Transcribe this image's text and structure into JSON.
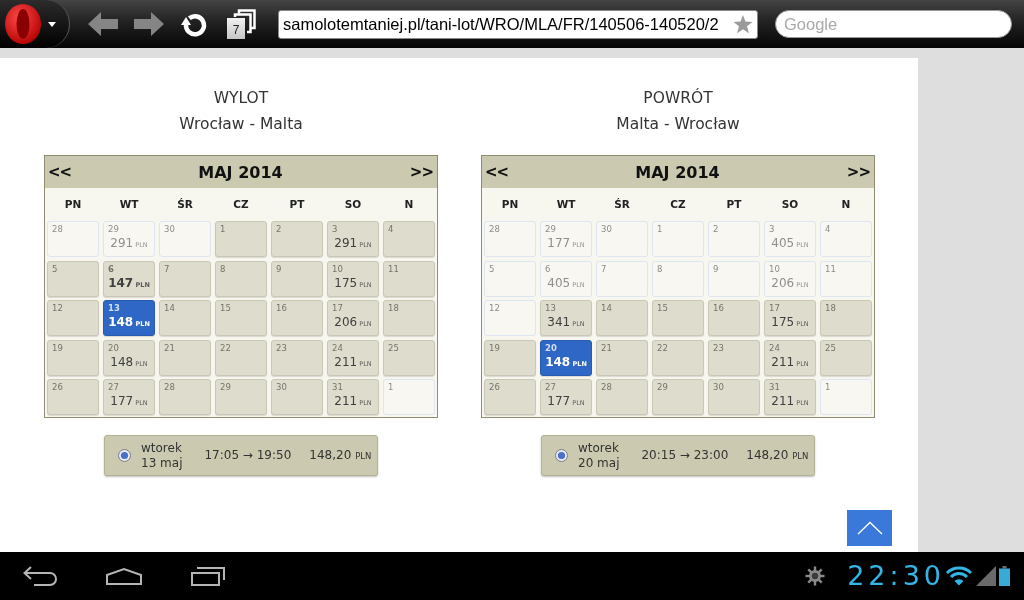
{
  "browser": {
    "nav_buttons": [
      {
        "kind": "back",
        "disabled": true
      },
      {
        "kind": "forward",
        "disabled": true
      },
      {
        "kind": "reload",
        "disabled": false
      }
    ],
    "tab_count": "7",
    "url": "samolotemtaniej.pl/tani-lot/WRO/MLA/FR/140506-140520/2",
    "search_placeholder": "Google"
  },
  "sections": [
    {
      "title": "WYLOT",
      "route": "Wrocław - Malta",
      "calendar": {
        "prev": "<<",
        "month": "MAJ 2014",
        "next": ">>",
        "weekdays": [
          "PN",
          "WT",
          "ŚR",
          "CZ",
          "PT",
          "SO",
          "N"
        ],
        "days": [
          {
            "day": "28",
            "disabled": true,
            "selected": false,
            "highlighted": false
          },
          {
            "day": "29",
            "price": "291",
            "currency": "PLN",
            "disabled": true,
            "selected": false,
            "highlighted": false
          },
          {
            "day": "30",
            "disabled": true,
            "selected": false,
            "highlighted": false
          },
          {
            "day": "1",
            "disabled": false,
            "selected": false,
            "highlighted": false
          },
          {
            "day": "2",
            "disabled": false,
            "selected": false,
            "highlighted": false
          },
          {
            "day": "3",
            "price": "291",
            "currency": "PLN",
            "disabled": false,
            "selected": false,
            "highlighted": false
          },
          {
            "day": "4",
            "disabled": false,
            "selected": false,
            "highlighted": false
          },
          {
            "day": "5",
            "disabled": false,
            "selected": false,
            "highlighted": false
          },
          {
            "day": "6",
            "price": "147",
            "currency": "PLN",
            "disabled": false,
            "selected": false,
            "highlighted": true
          },
          {
            "day": "7",
            "disabled": false,
            "selected": false,
            "highlighted": false
          },
          {
            "day": "8",
            "disabled": false,
            "selected": false,
            "highlighted": false
          },
          {
            "day": "9",
            "disabled": false,
            "selected": false,
            "highlighted": false
          },
          {
            "day": "10",
            "price": "175",
            "currency": "PLN",
            "disabled": false,
            "selected": false,
            "highlighted": false
          },
          {
            "day": "11",
            "disabled": false,
            "selected": false,
            "highlighted": false
          },
          {
            "day": "12",
            "disabled": false,
            "selected": false,
            "highlighted": false
          },
          {
            "day": "13",
            "price": "148",
            "currency": "PLN",
            "disabled": false,
            "selected": true,
            "highlighted": false
          },
          {
            "day": "14",
            "disabled": false,
            "selected": false,
            "highlighted": false
          },
          {
            "day": "15",
            "disabled": false,
            "selected": false,
            "highlighted": false
          },
          {
            "day": "16",
            "disabled": false,
            "selected": false,
            "highlighted": false
          },
          {
            "day": "17",
            "price": "206",
            "currency": "PLN",
            "disabled": false,
            "selected": false,
            "highlighted": false
          },
          {
            "day": "18",
            "disabled": false,
            "selected": false,
            "highlighted": false
          },
          {
            "day": "19",
            "disabled": false,
            "selected": false,
            "highlighted": false
          },
          {
            "day": "20",
            "price": "148",
            "currency": "PLN",
            "disabled": false,
            "selected": false,
            "highlighted": false
          },
          {
            "day": "21",
            "disabled": false,
            "selected": false,
            "highlighted": false
          },
          {
            "day": "22",
            "disabled": false,
            "selected": false,
            "highlighted": false
          },
          {
            "day": "23",
            "disabled": false,
            "selected": false,
            "highlighted": false
          },
          {
            "day": "24",
            "price": "211",
            "currency": "PLN",
            "disabled": false,
            "selected": false,
            "highlighted": false
          },
          {
            "day": "25",
            "disabled": false,
            "selected": false,
            "highlighted": false
          },
          {
            "day": "26",
            "disabled": false,
            "selected": false,
            "highlighted": false
          },
          {
            "day": "27",
            "price": "177",
            "currency": "PLN",
            "disabled": false,
            "selected": false,
            "highlighted": false
          },
          {
            "day": "28",
            "disabled": false,
            "selected": false,
            "highlighted": false
          },
          {
            "day": "29",
            "disabled": false,
            "selected": false,
            "highlighted": false
          },
          {
            "day": "30",
            "disabled": false,
            "selected": false,
            "highlighted": false
          },
          {
            "day": "31",
            "price": "211",
            "currency": "PLN",
            "disabled": false,
            "selected": false,
            "highlighted": false
          },
          {
            "day": "1",
            "disabled": true,
            "selected": false,
            "highlighted": false
          }
        ]
      },
      "flight": {
        "selected": true,
        "weekday": "wtorek",
        "date": "13 maj",
        "times": "17:05 → 19:50",
        "price": "148,20",
        "currency": "PLN"
      }
    },
    {
      "title": "POWRÓT",
      "route": "Malta - Wrocław",
      "calendar": {
        "prev": "<<",
        "month": "MAJ 2014",
        "next": ">>",
        "weekdays": [
          "PN",
          "WT",
          "ŚR",
          "CZ",
          "PT",
          "SO",
          "N"
        ],
        "days": [
          {
            "day": "28",
            "disabled": true,
            "selected": false,
            "highlighted": false
          },
          {
            "day": "29",
            "price": "177",
            "currency": "PLN",
            "disabled": true,
            "selected": false,
            "highlighted": false
          },
          {
            "day": "30",
            "disabled": true,
            "selected": false,
            "highlighted": false
          },
          {
            "day": "1",
            "disabled": true,
            "selected": false,
            "highlighted": false
          },
          {
            "day": "2",
            "disabled": true,
            "selected": false,
            "highlighted": false
          },
          {
            "day": "3",
            "price": "405",
            "currency": "PLN",
            "disabled": true,
            "selected": false,
            "highlighted": false
          },
          {
            "day": "4",
            "disabled": true,
            "selected": false,
            "highlighted": false
          },
          {
            "day": "5",
            "disabled": true,
            "selected": false,
            "highlighted": false
          },
          {
            "day": "6",
            "price": "405",
            "currency": "PLN",
            "disabled": true,
            "selected": false,
            "highlighted": false
          },
          {
            "day": "7",
            "disabled": true,
            "selected": false,
            "highlighted": false
          },
          {
            "day": "8",
            "disabled": true,
            "selected": false,
            "highlighted": false
          },
          {
            "day": "9",
            "disabled": true,
            "selected": false,
            "highlighted": false
          },
          {
            "day": "10",
            "price": "206",
            "currency": "PLN",
            "disabled": true,
            "selected": false,
            "highlighted": false
          },
          {
            "day": "11",
            "disabled": true,
            "selected": false,
            "highlighted": false
          },
          {
            "day": "12",
            "disabled": true,
            "selected": false,
            "highlighted": false
          },
          {
            "day": "13",
            "price": "341",
            "currency": "PLN",
            "disabled": false,
            "selected": false,
            "highlighted": false
          },
          {
            "day": "14",
            "disabled": false,
            "selected": false,
            "highlighted": false
          },
          {
            "day": "15",
            "disabled": false,
            "selected": false,
            "highlighted": false
          },
          {
            "day": "16",
            "disabled": false,
            "selected": false,
            "highlighted": false
          },
          {
            "day": "17",
            "price": "175",
            "currency": "PLN",
            "disabled": false,
            "selected": false,
            "highlighted": false
          },
          {
            "day": "18",
            "disabled": false,
            "selected": false,
            "highlighted": false
          },
          {
            "day": "19",
            "disabled": false,
            "selected": false,
            "highlighted": false
          },
          {
            "day": "20",
            "price": "148",
            "currency": "PLN",
            "disabled": false,
            "selected": true,
            "highlighted": false
          },
          {
            "day": "21",
            "disabled": false,
            "selected": false,
            "highlighted": false
          },
          {
            "day": "22",
            "disabled": false,
            "selected": false,
            "highlighted": false
          },
          {
            "day": "23",
            "disabled": false,
            "selected": false,
            "highlighted": false
          },
          {
            "day": "24",
            "price": "211",
            "currency": "PLN",
            "disabled": false,
            "selected": false,
            "highlighted": false
          },
          {
            "day": "25",
            "disabled": false,
            "selected": false,
            "highlighted": false
          },
          {
            "day": "26",
            "disabled": false,
            "selected": false,
            "highlighted": false
          },
          {
            "day": "27",
            "price": "177",
            "currency": "PLN",
            "disabled": false,
            "selected": false,
            "highlighted": false
          },
          {
            "day": "28",
            "disabled": false,
            "selected": false,
            "highlighted": false
          },
          {
            "day": "29",
            "disabled": false,
            "selected": false,
            "highlighted": false
          },
          {
            "day": "30",
            "disabled": false,
            "selected": false,
            "highlighted": false
          },
          {
            "day": "31",
            "price": "211",
            "currency": "PLN",
            "disabled": false,
            "selected": false,
            "highlighted": false
          },
          {
            "day": "1",
            "disabled": true,
            "selected": false,
            "highlighted": false
          }
        ]
      },
      "flight": {
        "selected": true,
        "weekday": "wtorek",
        "date": "20 maj",
        "times": "20:15 → 23:00",
        "price": "148,20",
        "currency": "PLN"
      }
    }
  ],
  "status_bar": {
    "time": "22:30"
  }
}
